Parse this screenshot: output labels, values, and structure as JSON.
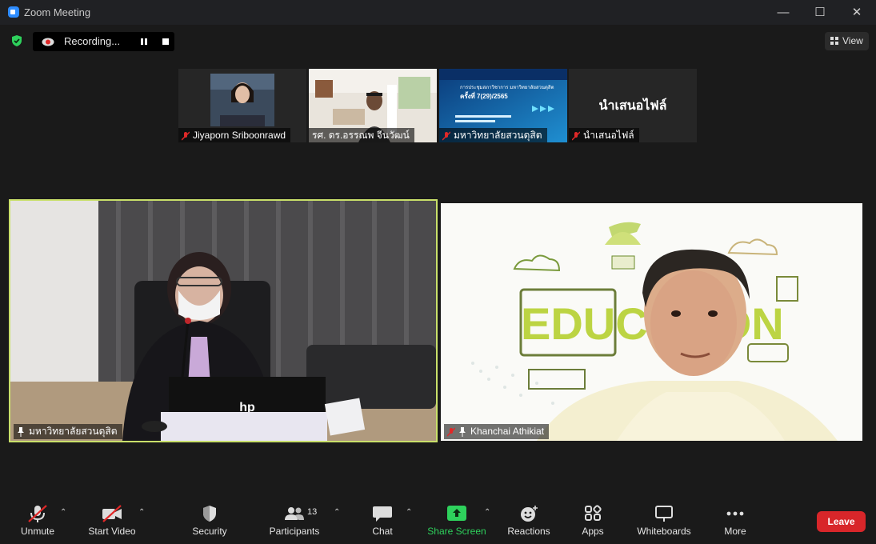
{
  "window": {
    "title": "Zoom Meeting"
  },
  "recording": {
    "label": "Recording..."
  },
  "view_button": {
    "label": "View"
  },
  "thumbnails": [
    {
      "name": "Jiyaporn Sriboonrawd",
      "muted": true
    },
    {
      "name": "รศ. ดร.อรรณพ จีนวัฒน์",
      "muted": false
    },
    {
      "name": "มหาวิทยาลัยสวนดุสิต",
      "muted": true,
      "slide_title": "การประชุมสภาวิชาการ มหาวิทยาลัยสวนดุสิต",
      "slide_subtitle": "ครั้งที่ 7(29)/2565"
    },
    {
      "name": "นำเสนอไฟล์",
      "muted": true,
      "display_name": "นำเสนอไฟล์"
    }
  ],
  "main_tiles": [
    {
      "name": "มหาวิทยาลัยสวนดุสิต",
      "pinned": true,
      "active_speaker": true,
      "laptop_brand": "hp"
    },
    {
      "name": "Khanchai Athikiat",
      "pinned": true,
      "muted": true,
      "background_word": "EDUCATION"
    }
  ],
  "toolbar": {
    "unmute": "Unmute",
    "start_video": "Start Video",
    "security": "Security",
    "participants": "Participants",
    "participants_count": "13",
    "chat": "Chat",
    "share_screen": "Share Screen",
    "reactions": "Reactions",
    "apps": "Apps",
    "whiteboards": "Whiteboards",
    "more": "More",
    "leave": "Leave"
  },
  "colors": {
    "share_green": "#2ed15c",
    "leave_red": "#d8262a",
    "active_speaker_border": "#c9e06a",
    "muted_red": "#e02828"
  }
}
